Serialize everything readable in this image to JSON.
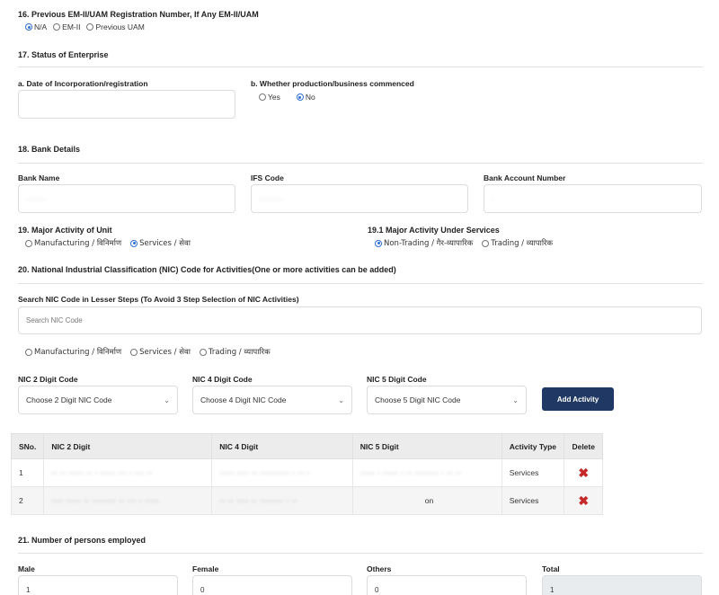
{
  "s16": {
    "title": "16. Previous EM-II/UAM Registration Number, If Any EM-II/UAM",
    "options": [
      "N/A",
      "EM-II",
      "Previous UAM"
    ],
    "selected": 0
  },
  "s17": {
    "title": "17. Status of Enterprise",
    "a_label": "a. Date of Incorporation/registration",
    "a_value": "",
    "b_label": "b. Whether production/business commenced",
    "b_options": [
      "Yes",
      "No"
    ],
    "b_selected": 1
  },
  "s18": {
    "title": "18. Bank Details",
    "bank_name_label": "Bank Name",
    "bank_name_value": "········",
    "ifs_label": "IFS Code",
    "ifs_value": "··········",
    "account_label": "Bank Account Number",
    "account_value": "·"
  },
  "s19": {
    "title": "19. Major Activity of Unit",
    "options": [
      "Manufacturing / विनिर्माण",
      "Services / सेवा"
    ],
    "selected": 1,
    "sub_title": "19.1 Major Activity Under Services",
    "sub_options": [
      "Non-Trading / गैर-व्यापारिक",
      "Trading / व्यापारिक"
    ],
    "sub_selected": 0
  },
  "s20": {
    "title": "20. National Industrial Classification (NIC) Code for Activities(One or more activities can be added)",
    "search_label": "Search NIC Code in Lesser Steps (To Avoid 3 Step Selection of NIC Activities)",
    "search_placeholder": "Search NIC Code",
    "filter_options": [
      "Manufacturing / विनिर्माण",
      "Services / सेवा",
      "Trading / व्यापारिक"
    ],
    "nic2_label": "NIC 2 Digit Code",
    "nic2_value": "Choose 2 Digit NIC Code",
    "nic4_label": "NIC 4 Digit Code",
    "nic4_value": "Choose 4 Digit NIC Code",
    "nic5_label": "NIC 5 Digit Code",
    "nic5_value": "Choose 5 Digit NIC Code",
    "add_button": "Add Activity",
    "table": {
      "headers": [
        "SNo.",
        "NIC 2 Digit",
        "NIC 4 Digit",
        "NIC 5 Digit",
        "Activity Type",
        "Delete"
      ],
      "rows": [
        {
          "sno": "1",
          "nic2": "·· ·· ····· ·· · ····· ··· · ··· ··",
          "nic4": "····· ···· ·· ·········· · ·· ·",
          "nic5": "····· · ····· · ·· ········ · ·· ··",
          "type": "Services",
          "delete": "✖"
        },
        {
          "sno": "2",
          "nic2": "···· ····· ·· ········ ·· ··· · ·····",
          "nic4": "·· ·· ···· ·· ········ · ··",
          "nic5": "on",
          "type": "Services",
          "delete": "✖"
        }
      ]
    }
  },
  "s21": {
    "title": "21. Number of persons employed",
    "male_label": "Male",
    "male_value": "1",
    "female_label": "Female",
    "female_value": "0",
    "others_label": "Others",
    "others_value": "0",
    "total_label": "Total",
    "total_value": "1"
  },
  "colors": {
    "accent": "#2f6fd6",
    "button": "#1f3864",
    "delete": "#c62828"
  }
}
